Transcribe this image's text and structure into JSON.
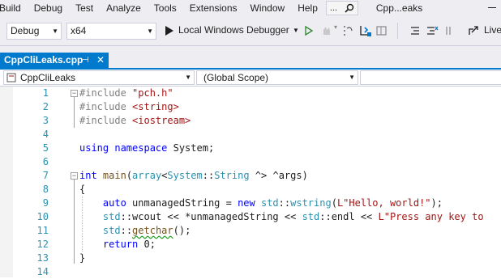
{
  "menu": {
    "items": [
      "Build",
      "Debug",
      "Test",
      "Analyze",
      "Tools",
      "Extensions",
      "Window",
      "Help"
    ],
    "search_dots": "...",
    "solution_title": "Cpp...eaks"
  },
  "toolbar": {
    "configuration": "Debug",
    "platform": "x64",
    "debugger_label": "Local Windows Debugger",
    "live_share": "Live"
  },
  "tab": {
    "title": "CppCliLeaks.cpp"
  },
  "navbar": {
    "project": "CppCliLeaks",
    "scope": "(Global Scope)"
  },
  "editor": {
    "line_numbers": [
      "1",
      "2",
      "3",
      "4",
      "5",
      "6",
      "7",
      "8",
      "9",
      "10",
      "11",
      "12",
      "13",
      "14"
    ],
    "lines": [
      [
        [
          "pp",
          "#include "
        ],
        [
          "str",
          "\"pch.h\""
        ]
      ],
      [
        [
          "pp",
          "#include "
        ],
        [
          "str",
          "<string>"
        ]
      ],
      [
        [
          "pp",
          "#include "
        ],
        [
          "str",
          "<iostream>"
        ]
      ],
      [],
      [
        [
          "kw",
          "using namespace "
        ],
        [
          "tx",
          "System;"
        ]
      ],
      [],
      [
        [
          "kw",
          "int "
        ],
        [
          "fn",
          "main"
        ],
        [
          "tx",
          "("
        ],
        [
          "ty",
          "array"
        ],
        [
          "tx",
          "<"
        ],
        [
          "ty",
          "System"
        ],
        [
          "tx",
          "::"
        ],
        [
          "ty",
          "String"
        ],
        [
          "tx",
          " ^> ^args)"
        ]
      ],
      [
        [
          "tx",
          "{"
        ]
      ],
      [
        [
          "tx",
          "    "
        ],
        [
          "kw",
          "auto "
        ],
        [
          "tx",
          "unmanagedString = "
        ],
        [
          "kw",
          "new "
        ],
        [
          "ty",
          "std"
        ],
        [
          "tx",
          "::"
        ],
        [
          "ty",
          "wstring"
        ],
        [
          "tx",
          "("
        ],
        [
          "str",
          "L\"Hello, world!\""
        ],
        [
          "tx",
          ");"
        ]
      ],
      [
        [
          "tx",
          "    "
        ],
        [
          "ty",
          "std"
        ],
        [
          "tx",
          "::wcout << *unmanagedString << "
        ],
        [
          "ty",
          "std"
        ],
        [
          "tx",
          "::endl << "
        ],
        [
          "str",
          "L\"Press any key to"
        ]
      ],
      [
        [
          "tx",
          "    "
        ],
        [
          "ty",
          "std"
        ],
        [
          "tx",
          "::"
        ],
        [
          "fn-sq",
          "getchar"
        ],
        [
          "tx",
          "();"
        ]
      ],
      [
        [
          "tx",
          "    "
        ],
        [
          "kw",
          "return "
        ],
        [
          "tx",
          "0;"
        ]
      ],
      [
        [
          "tx",
          "}"
        ]
      ],
      []
    ]
  }
}
